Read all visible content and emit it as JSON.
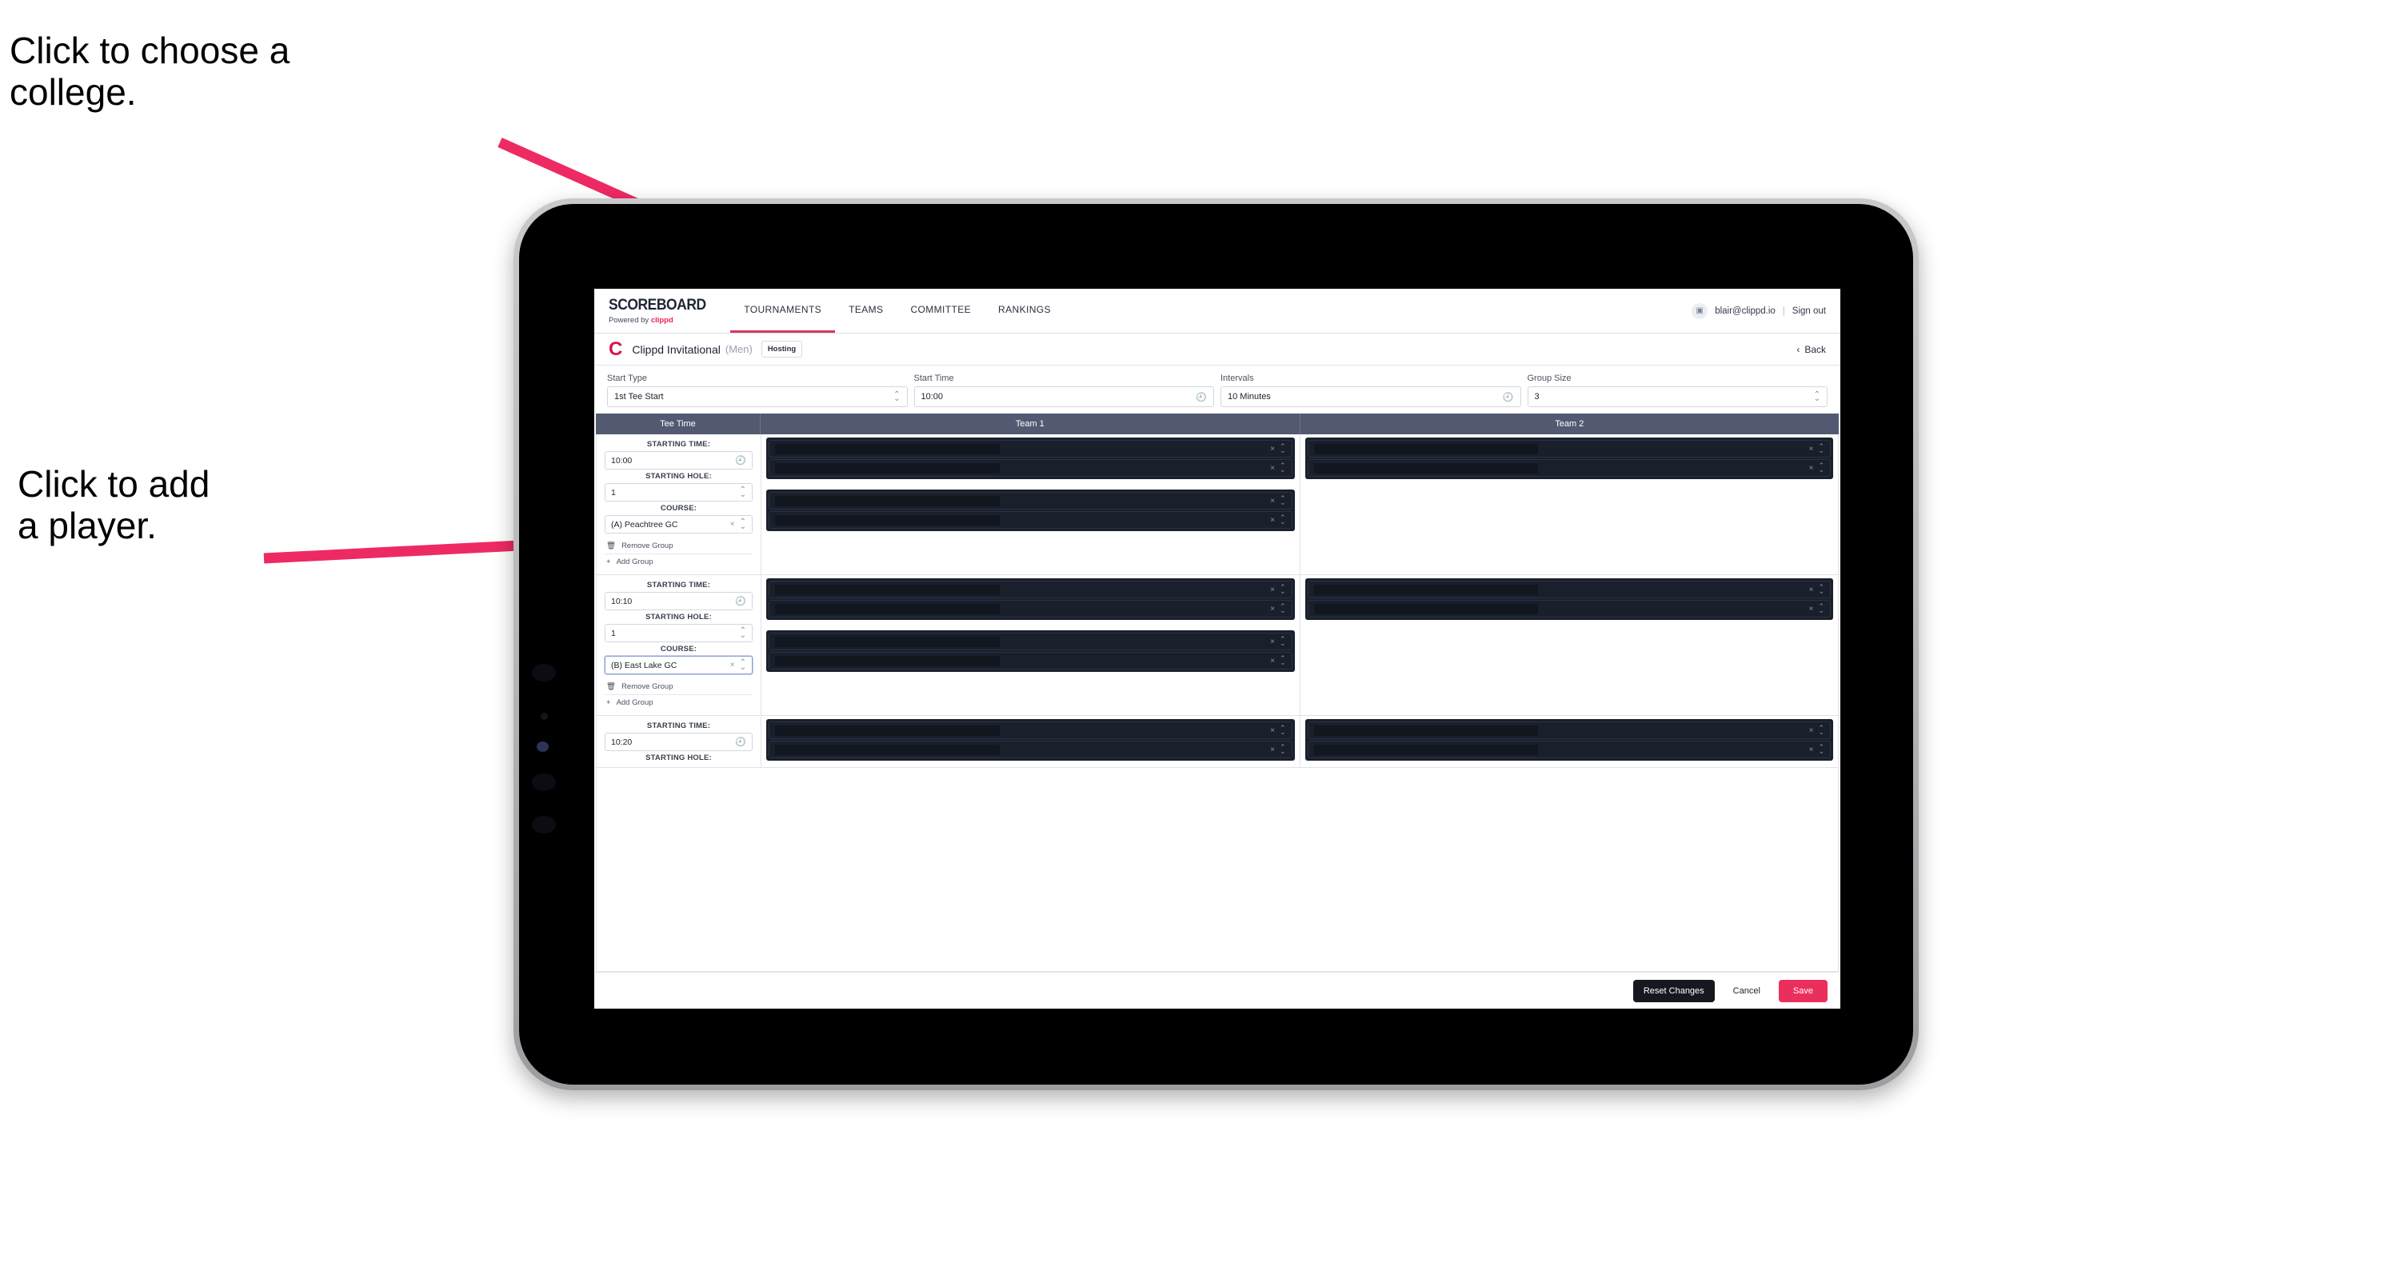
{
  "annotations": {
    "college": "Click to choose a\ncollege.",
    "player": "Click to add\na player."
  },
  "topnav": {
    "brand_word": "SCOREBOARD",
    "brand_sub_prefix": "Powered by ",
    "brand_sub_name": "clippd",
    "tabs": [
      {
        "label": "TOURNAMENTS",
        "active": true
      },
      {
        "label": "TEAMS",
        "active": false
      },
      {
        "label": "COMMITTEE",
        "active": false
      },
      {
        "label": "RANKINGS",
        "active": false
      }
    ],
    "account_icon": "▣",
    "email": "blair@clippd.io",
    "separator": "|",
    "signout": "Sign out"
  },
  "tournament": {
    "logo_letter": "C",
    "name": "Clippd Invitational",
    "gender": "(Men)",
    "badge": "Hosting",
    "back_chevron": "‹",
    "back_label": "Back"
  },
  "filters": [
    {
      "label": "Start Type",
      "value": "1st Tee Start",
      "control": "stepper"
    },
    {
      "label": "Start Time",
      "value": "10:00",
      "control": "clock"
    },
    {
      "label": "Intervals",
      "value": "10 Minutes",
      "control": "clock"
    },
    {
      "label": "Group Size",
      "value": "3",
      "control": "stepper"
    }
  ],
  "table": {
    "headers": {
      "tee_time": "Tee Time",
      "team1": "Team 1",
      "team2": "Team 2"
    },
    "field_labels": {
      "starting_time": "STARTING TIME:",
      "starting_hole": "STARTING HOLE:",
      "course": "COURSE:"
    },
    "group_actions": {
      "remove_icon": "trash-icon",
      "remove_label": "Remove Group",
      "add_icon": "+",
      "add_label": "Add Group"
    },
    "slot_clear_icon": "×",
    "rows": [
      {
        "starting_time": "10:00",
        "starting_hole": "1",
        "course": "(A) Peachtree GC",
        "course_focused": false,
        "team1_blocks": [
          {
            "slots": 2
          },
          {
            "slots": 2
          }
        ],
        "team2_blocks": [
          {
            "slots": 2
          }
        ]
      },
      {
        "starting_time": "10:10",
        "starting_hole": "1",
        "course": "(B) East Lake GC",
        "course_focused": true,
        "team1_blocks": [
          {
            "slots": 2
          },
          {
            "slots": 2
          }
        ],
        "team2_blocks": [
          {
            "slots": 2
          }
        ]
      },
      {
        "starting_time": "10:20",
        "starting_hole": "",
        "course": "",
        "course_focused": false,
        "team1_blocks": [
          {
            "slots": 2
          }
        ],
        "team2_blocks": [
          {
            "slots": 2
          }
        ]
      }
    ]
  },
  "footer": {
    "reset": "Reset Changes",
    "cancel": "Cancel",
    "save": "Save"
  },
  "colors": {
    "accent_pink": "#ea2f5d",
    "brand_red": "#d9154b",
    "table_header": "#525a71",
    "slot_dark": "#1a1f2c",
    "annotation_arrow": "#ee2a62"
  }
}
